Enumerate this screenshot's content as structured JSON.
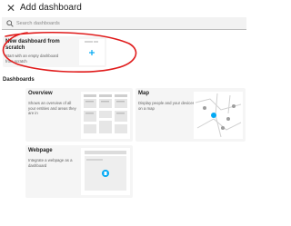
{
  "header": {
    "close_icon": "close-icon",
    "title": "Add dashboard"
  },
  "search": {
    "placeholder": "Search dashboards",
    "icon": "search-icon"
  },
  "new_dashboard": {
    "title": "New dashboard from scratch",
    "description": "Start with an empty dashboard from scratch",
    "icon": "plus-icon"
  },
  "section": {
    "title": "Dashboards"
  },
  "cards": {
    "overview": {
      "title": "Overview",
      "description": "Shows an overview of all your entities and areas they are in"
    },
    "map": {
      "title": "Map",
      "description": "Display people and your devices on a map"
    },
    "webpage": {
      "title": "Webpage",
      "description": "Integrate a webpage as a dashboard"
    }
  },
  "colors": {
    "accent": "#03a9f4",
    "annotation": "#e01b1b",
    "card_bg": "#f5f5f5"
  }
}
